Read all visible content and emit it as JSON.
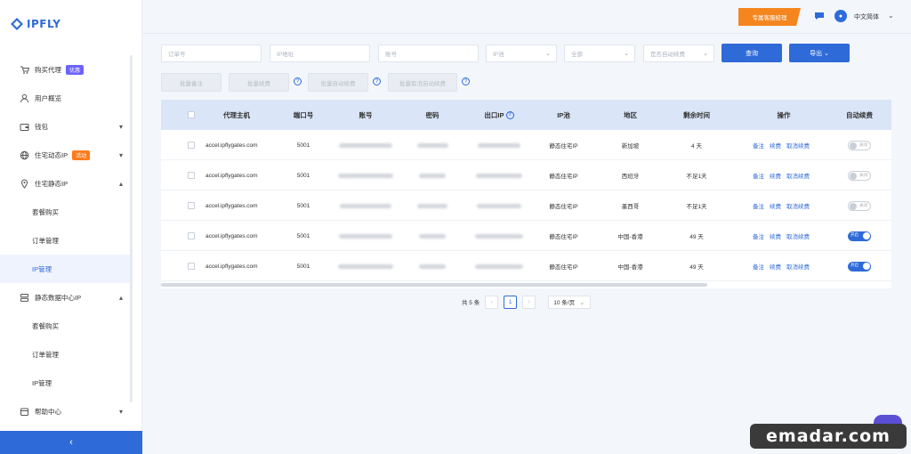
{
  "brand": {
    "name": "IPFLY"
  },
  "sidebar": {
    "items": [
      {
        "label": "购买代理",
        "icon": "cart-icon",
        "badge": "优惠",
        "badge_color": "#6c63ff"
      },
      {
        "label": "用户概览",
        "icon": "user-icon"
      },
      {
        "label": "钱包",
        "icon": "wallet-icon"
      },
      {
        "label": "住宅动态IP",
        "icon": "globe-icon",
        "badge": "活动",
        "badge_color": "#ff7a1a"
      },
      {
        "label": "住宅静态IP",
        "icon": "pin-icon"
      },
      {
        "label": "套餐购买"
      },
      {
        "label": "订单管理"
      },
      {
        "label": "IP管理"
      },
      {
        "label": "静态数据中心IP",
        "icon": "server-icon"
      },
      {
        "label": "套餐购买"
      },
      {
        "label": "订单管理"
      },
      {
        "label": "IP管理"
      },
      {
        "label": "帮助中心",
        "icon": "calendar-icon"
      }
    ],
    "collapse": "‹"
  },
  "header": {
    "promo": "专属客服经理",
    "language": "中文简体"
  },
  "filters": {
    "order_placeholder": "订单号",
    "ip_placeholder": "IP地址",
    "account_placeholder": "账号",
    "pool_placeholder": "IP池",
    "all_placeholder": "全部",
    "autorenew_placeholder": "是否自动续费",
    "query": "查询",
    "export": "导出"
  },
  "bulk": {
    "note": "批量备注",
    "renew": "批量续费",
    "autorenew": "批量自动续费",
    "cancel_autorenew": "批量取消自动续费"
  },
  "table": {
    "columns": [
      "代理主机",
      "端口号",
      "账号",
      "密码",
      "出口IP",
      "IP池",
      "地区",
      "剩余时间",
      "操作",
      "自动续费"
    ],
    "actions": [
      "备注",
      "续费",
      "取消续费"
    ],
    "toggle_on": "开启",
    "toggle_off": "关闭",
    "rows": [
      {
        "host": "accel.ipflygates.com",
        "port": "5001",
        "pool": "静态住宅IP",
        "region": "新加坡",
        "remaining": "4 天",
        "auto": false
      },
      {
        "host": "accel.ipflygates.com",
        "port": "5001",
        "pool": "静态住宅IP",
        "region": "西班牙",
        "remaining": "不足1天",
        "auto": false
      },
      {
        "host": "accel.ipflygates.com",
        "port": "5001",
        "pool": "静态住宅IP",
        "region": "墨西哥",
        "remaining": "不足1天",
        "auto": false
      },
      {
        "host": "accel.ipflygates.com",
        "port": "5001",
        "pool": "静态住宅IP",
        "region": "中国-香港",
        "remaining": "49 天",
        "auto": true
      },
      {
        "host": "accel.ipflygates.com",
        "port": "5001",
        "pool": "静态住宅IP",
        "region": "中国-香港",
        "remaining": "49 天",
        "auto": true
      }
    ]
  },
  "pagination": {
    "total": "共 5 条",
    "current": "1",
    "page_size": "10 条/页"
  },
  "watermark": "emadar.com"
}
